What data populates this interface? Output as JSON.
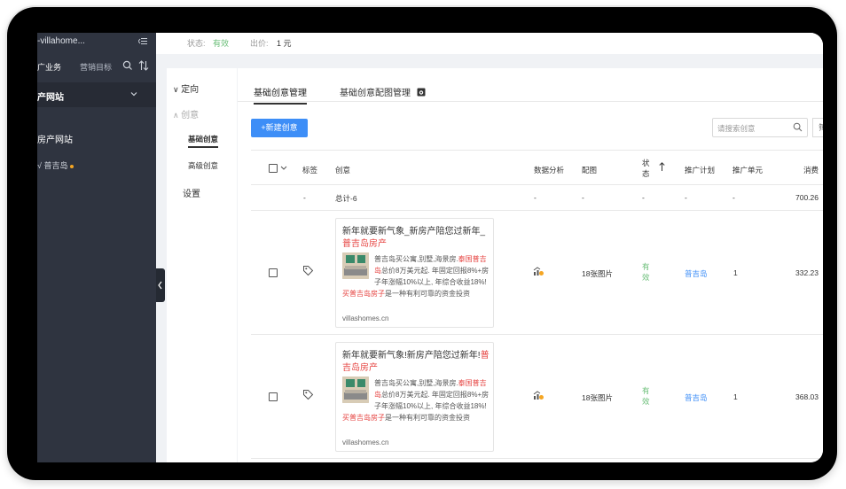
{
  "sidebar": {
    "account": "-villahome...",
    "tab_business": "广业务",
    "tab_goal": "营销目标",
    "site_header": "产网站",
    "site_sub": "房产网站",
    "item": "普吉岛"
  },
  "topbar": {
    "status_label": "状态:",
    "status_value": "有效",
    "bid_label": "出价:",
    "bid_value": "1 元"
  },
  "leftnav": {
    "section_target": "定向",
    "section_creative": "创意",
    "item_basic": "基础创意",
    "item_advanced": "高级创意",
    "section_settings": "设置"
  },
  "tabs": {
    "basic_manage": "基础创意管理",
    "basic_image_manage": "基础创意配图管理"
  },
  "toolbar": {
    "new_button": "+新建创意",
    "search_placeholder": "请搜索创意",
    "extra_button": "筛"
  },
  "table": {
    "headers": {
      "tag": "标签",
      "creative": "创意",
      "analysis": "数据分析",
      "image": "配图",
      "status": "状态",
      "plan": "推广计划",
      "unit": "推广单元",
      "spend": "消费"
    },
    "summary": {
      "tag": "-",
      "creative": "总计-6",
      "analysis": "-",
      "image": "-",
      "status": "-",
      "plan": "-",
      "unit": "-",
      "spend": "700.26"
    },
    "rows": [
      {
        "title_prefix": "新年就要新气象_新房产陪您过新年_",
        "title_highlight": "普吉岛房产",
        "desc_1": "普吉岛买公寓,别墅,海景房.",
        "desc_red1": "泰国普吉岛",
        "desc_2": "总价8万美元起. 年固定回报8%+房子年涨幅10%以上, 年综合收益18%!",
        "desc_red2": "买普吉岛房子",
        "desc_3": "是一种有利可靠的资金投资",
        "url": "villashomes.cn",
        "image": "18张图片",
        "status": "有效",
        "plan": "普吉岛",
        "unit": "1",
        "spend": "332.23"
      },
      {
        "title_prefix": "新年就要新气象!新房产陪您过新年!",
        "title_highlight": "普吉岛房产",
        "desc_1": "普吉岛买公寓,别墅,海景房.",
        "desc_red1": "泰国普吉岛",
        "desc_2": "总价8万美元起. 年固定回报8%+房子年涨幅10%以上, 年综合收益18%!",
        "desc_red2": "买普吉岛房子",
        "desc_3": "是一种有利可靠的资金投资",
        "url": "villashomes.cn",
        "image": "18张图片",
        "status": "有效",
        "plan": "普吉岛",
        "unit": "1",
        "spend": "368.03"
      }
    ]
  },
  "colors": {
    "accent": "#3d8ef7",
    "status_green": "#6cbf7a",
    "highlight_red": "#e64340",
    "sidebar_bg": "#2f3440"
  }
}
